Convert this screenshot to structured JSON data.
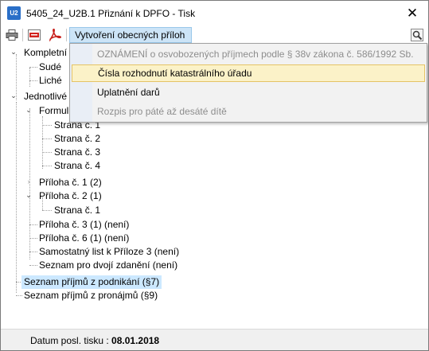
{
  "window": {
    "icon_text": "U2",
    "title": "5405_24_U2B.1 Přiznání k DPFO - Tisk",
    "close_glyph": "✕"
  },
  "toolbar": {
    "icons": [
      "printer-icon",
      "pdf-icon",
      "acrobat-icon",
      "settings-icon"
    ],
    "menu_label": "Vytvoření obecných příloh"
  },
  "dropdown": {
    "items": [
      {
        "label": "OZNÁMENÍ o osvobozených příjmech podle § 38v zákona č. 586/1992 Sb.",
        "enabled": false
      },
      {
        "label": "Čísla rozhodnutí katastrálního úřadu",
        "enabled": true,
        "highlighted": true
      },
      {
        "label": "Uplatnění darů",
        "enabled": true
      },
      {
        "label": "Rozpis pro páté až desáté dítě",
        "enabled": false
      }
    ]
  },
  "tree": {
    "nodes": [
      {
        "label": "Kompletní"
      },
      {
        "label": "Sudé"
      },
      {
        "label": "Liché"
      },
      {
        "label": "Jednotlivé"
      },
      {
        "label": "Formul"
      },
      {
        "label": "Strana č. 1"
      },
      {
        "label": "Strana č. 2"
      },
      {
        "label": "Strana č. 3"
      },
      {
        "label": "Strana č. 4"
      },
      {
        "label": "Příloha č. 1 (2)"
      },
      {
        "label": "Příloha č. 2 (1)"
      },
      {
        "label": "Strana č. 1"
      },
      {
        "label": "Příloha č. 3 (1) (není)"
      },
      {
        "label": "Příloha č. 6 (1) (není)"
      },
      {
        "label": "Samostatný list k Příloze 3 (není)"
      },
      {
        "label": "Seznam pro dvojí zdanění (není)"
      },
      {
        "label": "Seznam příjmů z podnikání (§7)",
        "selected": true
      },
      {
        "label": "Seznam příjmů z pronájmů (§9)"
      }
    ]
  },
  "status": {
    "label": "Datum posl. tisku :",
    "value": "08.01.2018"
  }
}
